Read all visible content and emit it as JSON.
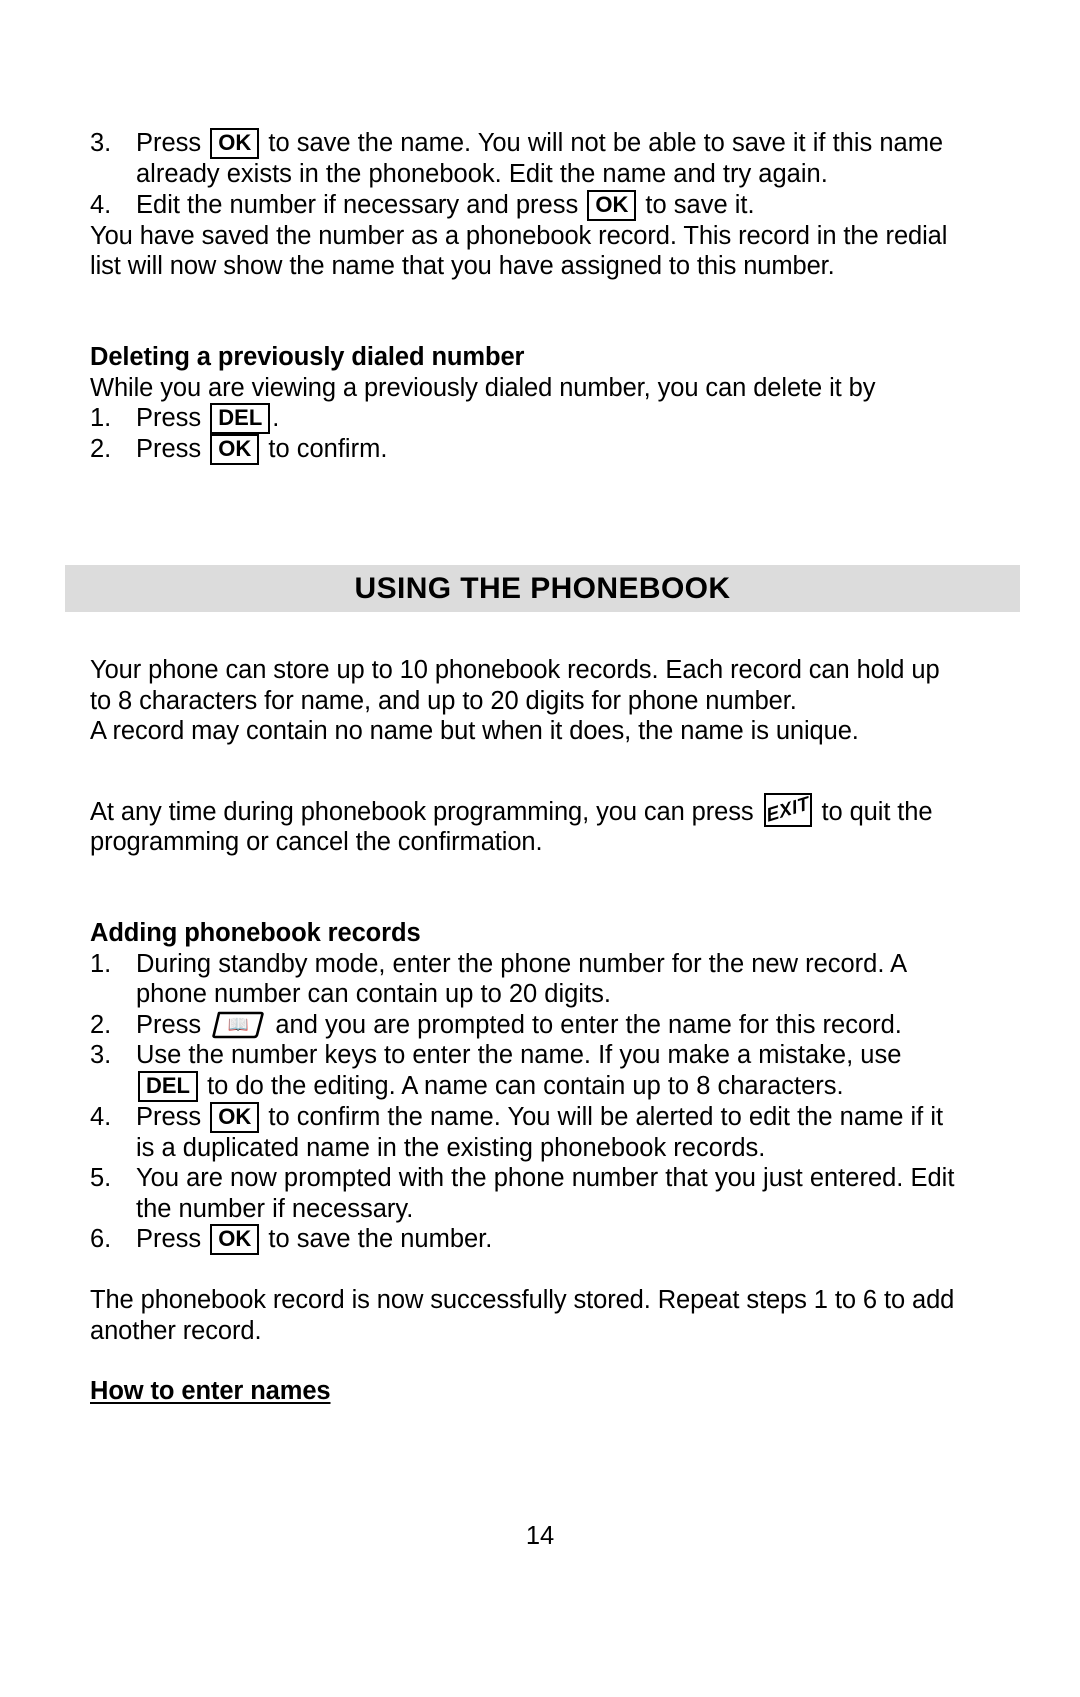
{
  "document": {
    "page_number": "14"
  },
  "top_section": {
    "steps": [
      {
        "num": "3.",
        "before": "Press",
        "key": "OK",
        "after": "to save the name.  You will not be able to save it if this name already exists in the phonebook.  Edit the name and try again."
      },
      {
        "num": "4.",
        "before": "Edit the number if necessary and press",
        "key": "OK",
        "after": "to save it."
      }
    ],
    "paragraph": "You have saved the number as a phonebook record.  This record in the redial list will now show the name that you have assigned to this number."
  },
  "deleting_section": {
    "heading": "Deleting a previously dialed number",
    "intro": "While you are viewing a previously dialed number, you can delete it by",
    "steps": [
      {
        "num": "1.",
        "before": "Press",
        "key": "DEL",
        "after": "."
      },
      {
        "num": "2.",
        "before": "Press",
        "key": "OK",
        "after": "to confirm."
      }
    ]
  },
  "banner": {
    "title": "USING THE PHONEBOOK"
  },
  "phonebook_intro": {
    "paragraph1": "Your phone can store up to 10 phonebook records.  Each record can hold up to 8 characters for name, and up to 20 digits for phone number.",
    "paragraph2": "A record may contain no name but when it does, the name is unique.",
    "exit_line_before": "At any time during phonebook programming, you can press",
    "exit_key_label": "EXIT",
    "exit_line_after": "to quit the programming or cancel the confirmation."
  },
  "adding_section": {
    "heading": "Adding phonebook records",
    "steps": [
      {
        "num": "1.",
        "text": "During standby mode, enter the phone number for the new record.  A phone number can contain up to 20 digits."
      },
      {
        "num": "2.",
        "before": "Press",
        "key_icon": "phonebook-book-icon",
        "key_glyph": "↗",
        "after": "and you are prompted to enter the name for this record."
      },
      {
        "num": "3.",
        "text_a": "Use the number keys to enter the name.  If you make a mistake, use",
        "key": "DEL",
        "text_b": "to do the editing.  A name can contain up to 8 characters."
      },
      {
        "num": "4.",
        "before": "Press",
        "key": "OK",
        "after": "to confirm the name.  You will be alerted to edit the name if it is a duplicated name in the existing phonebook records."
      },
      {
        "num": "5.",
        "text": "You are now prompted with the phone number that you just entered.  Edit the number if necessary."
      },
      {
        "num": "6.",
        "before": "Press",
        "key": "OK",
        "after": "to save the number."
      }
    ],
    "closing": "The phonebook record is now successfully stored.  Repeat steps 1 to 6 to add another record."
  },
  "enter_names_section": {
    "heading": "How to enter names"
  }
}
